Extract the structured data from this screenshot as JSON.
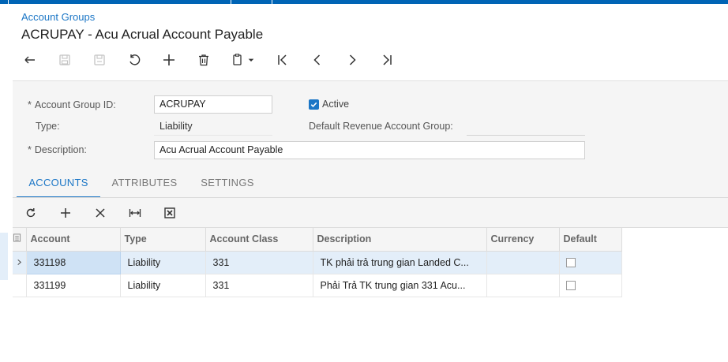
{
  "breadcrumb": "Account Groups",
  "page_title": "ACRUPAY - Acu Acrual Account Payable",
  "toolbar_icons": [
    "undo-back-icon",
    "save-disabled-icon",
    "save-close-disabled-icon",
    "cancel-icon",
    "add-icon",
    "delete-icon",
    "copy-paste-icon",
    "first-record-icon",
    "previous-record-icon",
    "next-record-icon",
    "last-record-icon"
  ],
  "form": {
    "account_group_id_label": "Account Group ID:",
    "account_group_id_value": "ACRUPAY",
    "active_label": "Active",
    "active_checked": true,
    "type_label": "Type:",
    "type_value": "Liability",
    "default_revenue_label": "Default Revenue Account Group:",
    "default_revenue_value": "",
    "description_label": "Description:",
    "description_value": "Acu Acrual Account Payable",
    "required_marker": "*"
  },
  "tabs": [
    {
      "label": "ACCOUNTS",
      "active": true
    },
    {
      "label": "ATTRIBUTES",
      "active": false
    },
    {
      "label": "SETTINGS",
      "active": false
    }
  ],
  "grid_toolbar_icons": [
    "refresh-icon",
    "add-row-icon",
    "delete-row-icon",
    "fit-columns-icon",
    "export-excel-icon"
  ],
  "grid": {
    "columns": [
      "Account",
      "Type",
      "Account Class",
      "Description",
      "Currency",
      "Default"
    ],
    "rows": [
      {
        "account": "331198",
        "type": "Liability",
        "account_class": "331",
        "description": "TK phải trả trung gian Landed C...",
        "currency": "",
        "default": false
      },
      {
        "account": "331199",
        "type": "Liability",
        "account_class": "331",
        "description": "Phải Trả TK trung gian 331 Acu...",
        "currency": "",
        "default": false
      }
    ]
  },
  "colors": {
    "accent": "#1b76c6",
    "topbar": "#0064b5",
    "selected_row": "#e3eef9"
  }
}
